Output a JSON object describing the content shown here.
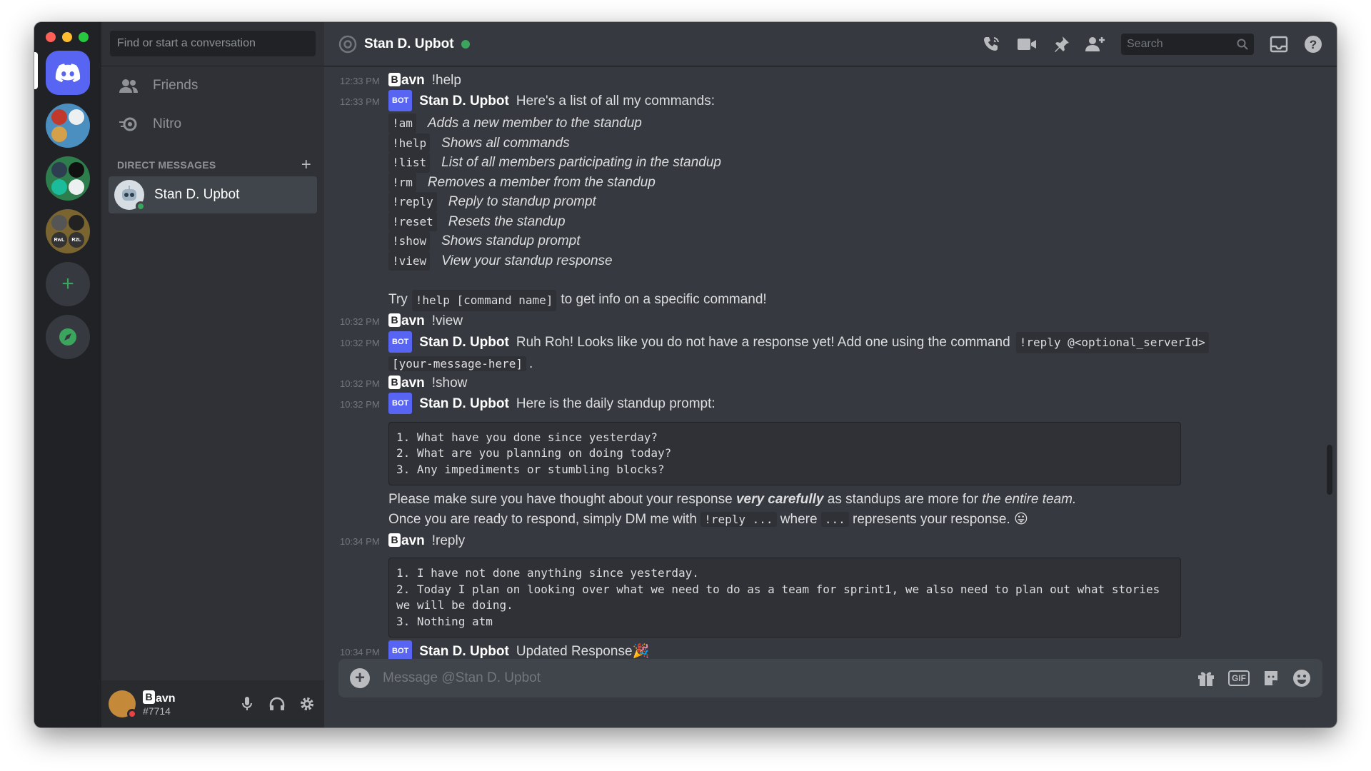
{
  "window": {
    "traffic_lights": [
      "close",
      "minimize",
      "zoom"
    ]
  },
  "colors": {
    "accent": "#5865f2",
    "online": "#3ba55d",
    "bg": "#36393f"
  },
  "rail": {
    "servers": [
      {
        "name": "home",
        "icon": "discord-icon"
      },
      {
        "name": "server-1"
      },
      {
        "name": "server-2"
      },
      {
        "name": "server-3",
        "labels": [
          "RwL",
          "R2L"
        ]
      }
    ],
    "add_server": "+",
    "explore": "compass-icon"
  },
  "sidebar": {
    "search_placeholder": "Find or start a conversation",
    "nav": [
      {
        "label": "Friends",
        "icon": "friends-icon"
      },
      {
        "label": "Nitro",
        "icon": "nitro-icon"
      }
    ],
    "dm_header": "DIRECT MESSAGES",
    "dm_add": "+",
    "dms": [
      {
        "label": "Stan D. Upbot",
        "status": "online"
      }
    ]
  },
  "user_panel": {
    "name_badge": "B",
    "name": "avn",
    "tag": "#7714"
  },
  "header": {
    "channel": "Stan D. Upbot",
    "search_placeholder": "Search"
  },
  "messages": {
    "m1": {
      "time": "12:33 PM",
      "badge": "B",
      "author": "avn",
      "text": "!help"
    },
    "m2": {
      "time": "12:33 PM",
      "bot": "BOT",
      "author": "Stan D. Upbot",
      "text": "Here's a list of all my commands:",
      "commands": [
        {
          "cmd": "!am",
          "desc": "Adds a new member to the standup"
        },
        {
          "cmd": "!help",
          "desc": "Shows all commands"
        },
        {
          "cmd": "!list",
          "desc": "List of all members participating in the standup"
        },
        {
          "cmd": "!rm",
          "desc": "Removes a member from the standup"
        },
        {
          "cmd": "!reply",
          "desc": "Reply to standup prompt"
        },
        {
          "cmd": "!reset",
          "desc": "Resets the standup"
        },
        {
          "cmd": "!show",
          "desc": "Shows standup prompt"
        },
        {
          "cmd": "!view",
          "desc": "View your standup response"
        }
      ],
      "try_pre": "Try",
      "try_code": "!help [command name]",
      "try_post": "to get info on a specific command!"
    },
    "m3": {
      "time": "10:32 PM",
      "badge": "B",
      "author": "avn",
      "text": "!view"
    },
    "m4": {
      "time": "10:32 PM",
      "bot": "BOT",
      "author": "Stan D. Upbot",
      "text": "Ruh Roh! Looks like you do not have a response yet! Add one using the command",
      "code1": "!reply @<optional_serverId>",
      "code2": "[your-message-here]",
      "end": "."
    },
    "m5": {
      "time": "10:32 PM",
      "badge": "B",
      "author": "avn",
      "text": "!show"
    },
    "m6": {
      "time": "10:32 PM",
      "bot": "BOT",
      "author": "Stan D. Upbot",
      "text": "Here is the daily standup prompt:",
      "block": "1. What have you done since yesterday?\n2. What are you planning on doing today?\n3. Any impediments or stumbling blocks?",
      "l1_pre": "Please make sure you have thought about your response",
      "l1_bold": "very carefully",
      "l1_mid": "as standups are more for",
      "l1_italic": "the entire team.",
      "l2_pre": "Once you are ready to respond, simply DM me with",
      "l2_code1": "!reply ...",
      "l2_mid": "where",
      "l2_code2": "...",
      "l2_post": "represents your response.",
      "l2_emoji": "😛"
    },
    "m7": {
      "time": "10:34 PM",
      "badge": "B",
      "author": "avn",
      "text": "!reply",
      "block": "1. I have not done anything since yesterday.\n2. Today I plan on looking over what we need to do as a team for sprint1, we also need to plan out what stories we will be doing.\n3. Nothing atm"
    },
    "m8": {
      "time": "10:34 PM",
      "bot": "BOT",
      "author": "Stan D. Upbot",
      "text": "Updated Response",
      "emoji": "🎉"
    }
  },
  "composer": {
    "placeholder": "Message @Stan D. Upbot",
    "gif": "GIF"
  }
}
